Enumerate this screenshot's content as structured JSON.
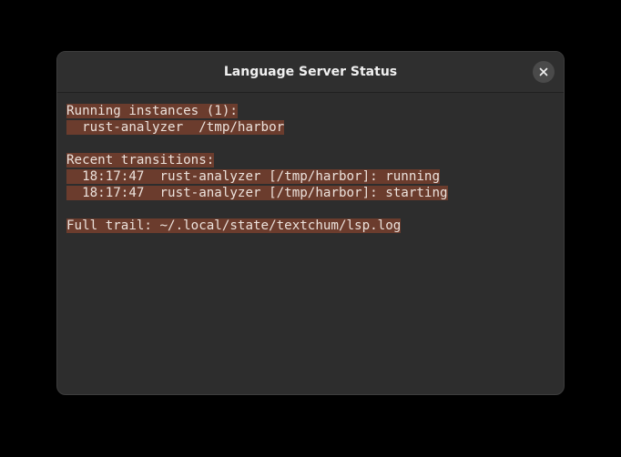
{
  "dialog": {
    "title": "Language Server Status",
    "close_icon": "close-icon"
  },
  "status": {
    "running_header": "Running instances (1):",
    "instances": [
      "  rust-analyzer  /tmp/harbor"
    ],
    "transitions_header": "Recent transitions:",
    "transitions": [
      "  18:17:47  rust-analyzer [/tmp/harbor]: running",
      "  18:17:47  rust-analyzer [/tmp/harbor]: starting"
    ],
    "trail": "Full trail: ~/.local/state/textchum/lsp.log"
  },
  "colors": {
    "highlight": "#6b3c2d",
    "background": "#2d2d2d",
    "text": "#ece2dc"
  }
}
